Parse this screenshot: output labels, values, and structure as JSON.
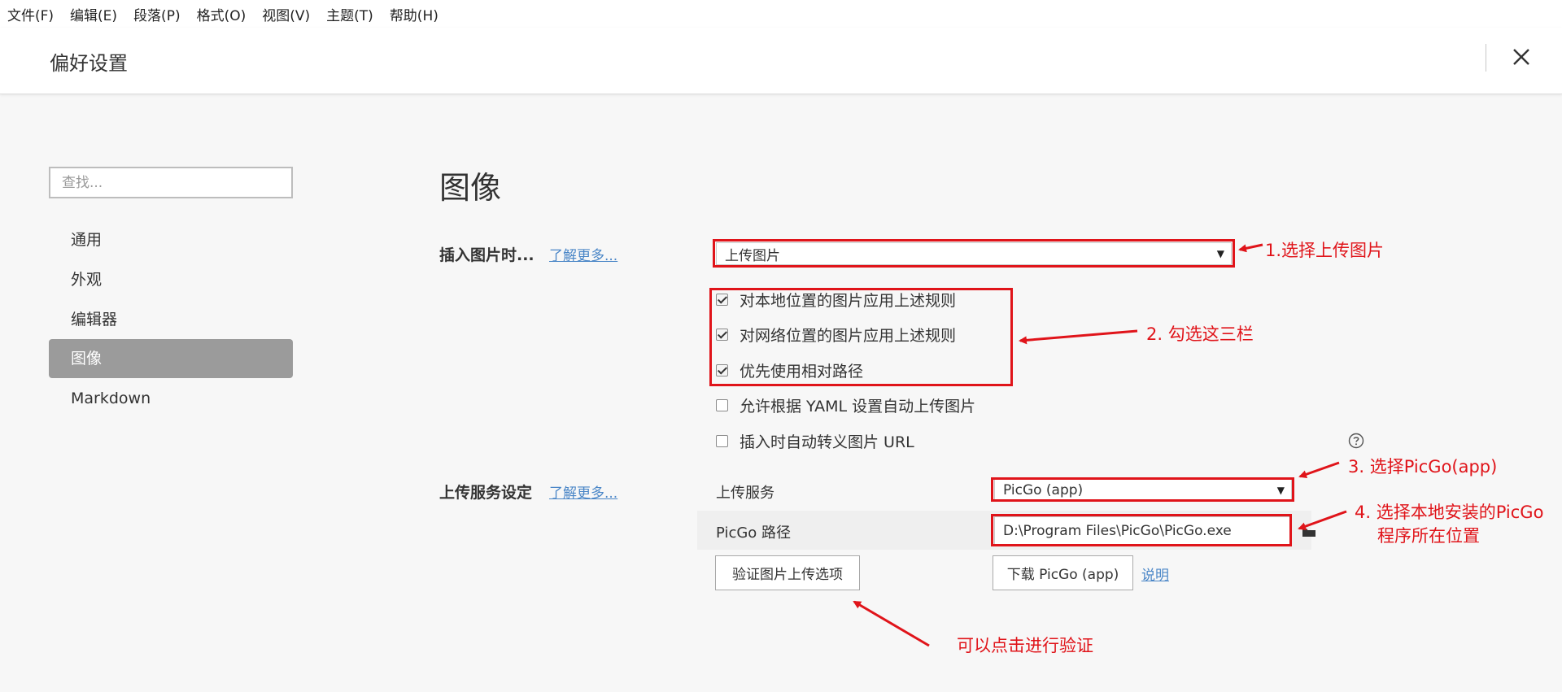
{
  "menu": [
    "文件(F)",
    "编辑(E)",
    "段落(P)",
    "格式(O)",
    "视图(V)",
    "主题(T)",
    "帮助(H)"
  ],
  "header": {
    "title": "偏好设置",
    "close_icon": "close-icon"
  },
  "sidebar": {
    "search_placeholder": "查找...",
    "items": [
      {
        "label": "通用",
        "active": false
      },
      {
        "label": "外观",
        "active": false
      },
      {
        "label": "编辑器",
        "active": false
      },
      {
        "label": "图像",
        "active": true
      },
      {
        "label": "Markdown",
        "active": false
      }
    ]
  },
  "main": {
    "title": "图像",
    "insert_image": {
      "label": "插入图片时...",
      "learn_more": "了解更多...",
      "select_value": "上传图片",
      "options": [
        {
          "label": "对本地位置的图片应用上述规则",
          "checked": true
        },
        {
          "label": "对网络位置的图片应用上述规则",
          "checked": true
        },
        {
          "label": "优先使用相对路径",
          "checked": true
        },
        {
          "label": "允许根据 YAML 设置自动上传图片",
          "checked": false
        },
        {
          "label": "插入时自动转义图片 URL",
          "checked": false
        }
      ],
      "help_icon": "help-circle-icon"
    },
    "upload_service": {
      "label": "上传服务设定",
      "learn_more": "了解更多...",
      "service_label": "上传服务",
      "service_value": "PicGo (app)",
      "path_label": "PicGo 路径",
      "path_value": "D:\\Program Files\\PicGo\\PicGo.exe",
      "folder_icon": "folder-icon",
      "verify_button": "验证图片上传选项",
      "download_button": "下载 PicGo (app)",
      "explain_link": "说明"
    }
  },
  "annotations": {
    "step1": "1.选择上传图片",
    "step2": "2. 勾选这三栏",
    "step3": "3. 选择PicGo(app)",
    "step4_line1": "4. 选择本地安装的PicGo",
    "step4_line2": "程序所在位置",
    "verify_hint": "可以点击进行验证",
    "color": "#e0141a"
  },
  "colors": {
    "active_nav": "#9b9b9b",
    "link": "#4a86c7",
    "background": "#f7f7f7"
  }
}
